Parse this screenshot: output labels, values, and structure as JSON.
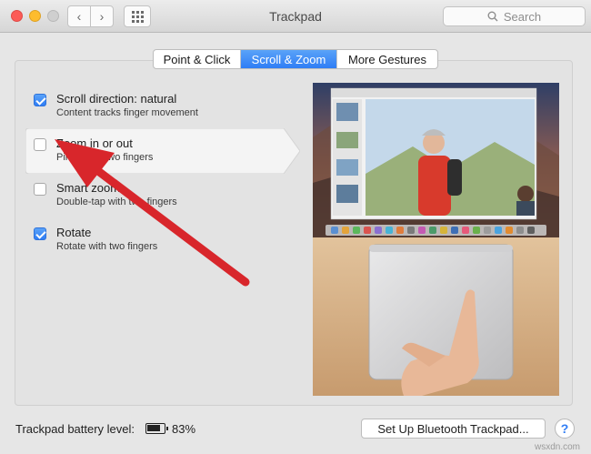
{
  "window": {
    "title": "Trackpad",
    "search_placeholder": "Search",
    "back_glyph": "‹",
    "forward_glyph": "›"
  },
  "tabs": [
    {
      "label": "Point & Click",
      "selected": false
    },
    {
      "label": "Scroll & Zoom",
      "selected": true
    },
    {
      "label": "More Gestures",
      "selected": false
    }
  ],
  "options": [
    {
      "title": "Scroll direction: natural",
      "subtitle": "Content tracks finger movement",
      "checked": true
    },
    {
      "title": "Zoom in or out",
      "subtitle": "Pinch with two fingers",
      "checked": false
    },
    {
      "title": "Smart zoom",
      "subtitle": "Double-tap with two fingers",
      "checked": false
    },
    {
      "title": "Rotate",
      "subtitle": "Rotate with two fingers",
      "checked": true
    }
  ],
  "footer": {
    "battery_label": "Trackpad battery level:",
    "battery_percent": "83%",
    "bluetooth_button": "Set Up Bluetooth Trackpad...",
    "help_label": "?"
  },
  "watermark": "wsxdn.com",
  "colors": {
    "accent": "#2f7df5",
    "annotation_arrow": "#d8262b"
  },
  "icons": {
    "search": "search-icon",
    "apps": "grid-icon",
    "battery": "battery-icon",
    "help": "help-icon"
  }
}
